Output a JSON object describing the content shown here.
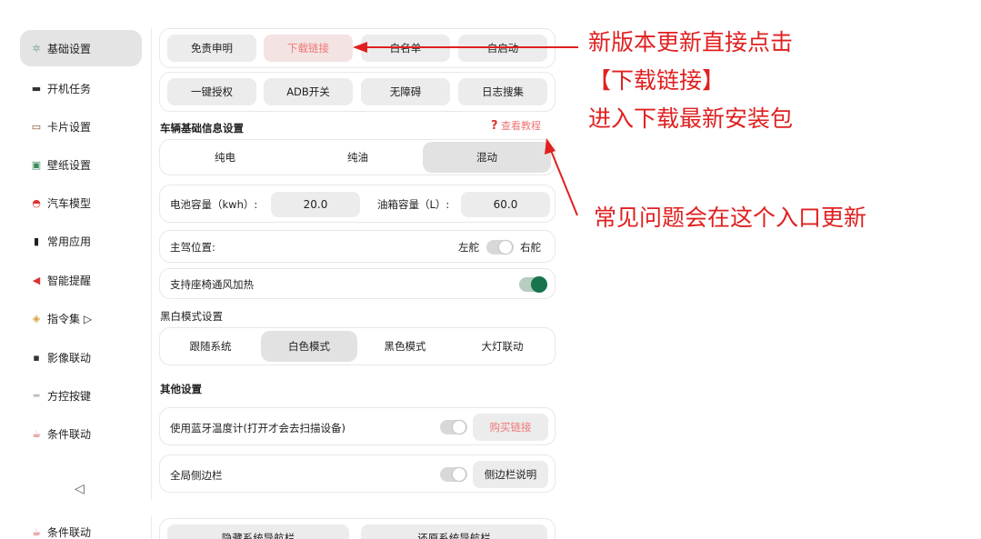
{
  "sidebar": {
    "items": [
      {
        "label": "基础设置",
        "icon": "gear-icon",
        "glyph": "✲"
      },
      {
        "label": "开机任务",
        "icon": "monitor-icon",
        "glyph": "▬"
      },
      {
        "label": "卡片设置",
        "icon": "card-icon",
        "glyph": "▭"
      },
      {
        "label": "壁纸设置",
        "icon": "wallpaper-icon",
        "glyph": "▣"
      },
      {
        "label": "汽车模型",
        "icon": "car-icon",
        "glyph": "◓"
      },
      {
        "label": "常用应用",
        "icon": "phone-icon",
        "glyph": "▮"
      },
      {
        "label": "智能提醒",
        "icon": "megaphone-icon",
        "glyph": "◀"
      },
      {
        "label": "指令集 ▷",
        "icon": "tag-icon",
        "glyph": "◈"
      },
      {
        "label": "影像联动",
        "icon": "camera-icon",
        "glyph": "▪"
      },
      {
        "label": "方控按键",
        "icon": "keyboard-icon",
        "glyph": "═"
      },
      {
        "label": "条件联动",
        "icon": "cup-icon",
        "glyph": "☕"
      }
    ],
    "back_glyph": "◁",
    "bottom_item": {
      "label": "条件联动",
      "glyph": "☕"
    }
  },
  "top_buttons_row1": [
    "免责申明",
    "下载链接",
    "白名单",
    "自启动"
  ],
  "top_buttons_row2": [
    "一键授权",
    "ADB开关",
    "无障碍",
    "日志搜集"
  ],
  "vehicle": {
    "title": "车辆基础信息设置",
    "tutorial_q": "?",
    "tutorial_label": "查看教程",
    "modes": [
      "纯电",
      "纯油",
      "混动"
    ],
    "battery_label": "电池容量（kwh）:",
    "battery_value": "20.0",
    "tank_label": "油箱容量（L）:",
    "tank_value": "60.0",
    "driver_label": "主驾位置:",
    "left_label": "左舵",
    "right_label": "右舵",
    "seat_label": "支持座椅通风加热"
  },
  "bw": {
    "title": "黑白模式设置",
    "options": [
      "跟随系统",
      "白色模式",
      "黑色模式",
      "大灯联动"
    ]
  },
  "other": {
    "title": "其他设置",
    "bt_label": "使用蓝牙温度计(打开才会去扫描设备)",
    "bt_button": "购买链接",
    "sidebar_label": "全局侧边栏",
    "sidebar_button": "侧边栏说明"
  },
  "bottom_buttons": [
    "隐藏系统导航栏",
    "还原系统导航栏"
  ],
  "annotations": {
    "line1": "新版本更新直接点击",
    "line2": "【下载链接】",
    "line3": "进入下载最新安装包",
    "line4": "常见问题会在这个入口更新"
  },
  "colors": {
    "accent_red": "#e02020",
    "toggle_on": "#17744d",
    "link_pink": "#e77777"
  }
}
